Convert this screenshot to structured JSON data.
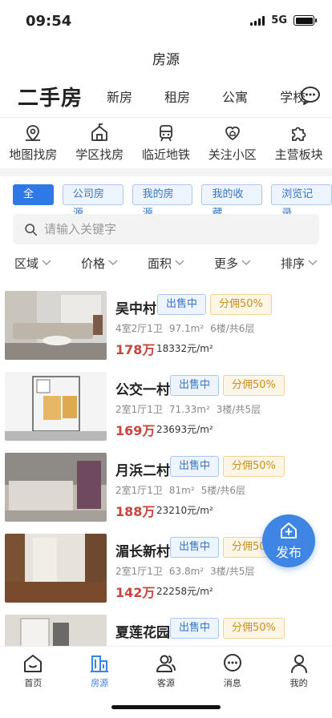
{
  "status": {
    "time": "09:54",
    "network": "5G"
  },
  "page_title": "房源",
  "tabs": {
    "main": "二手房",
    "others": [
      "新房",
      "租房",
      "公寓",
      "学校"
    ]
  },
  "quick_links": [
    {
      "label": "地图找房",
      "icon": "map-pin-icon"
    },
    {
      "label": "学区找房",
      "icon": "school-icon"
    },
    {
      "label": "临近地铁",
      "icon": "subway-icon"
    },
    {
      "label": "关注小区",
      "icon": "heart-home-icon"
    },
    {
      "label": "主营板块",
      "icon": "puzzle-icon"
    }
  ],
  "chips": [
    "全部",
    "公司房源",
    "我的房源",
    "我的收藏",
    "浏览记录"
  ],
  "search": {
    "placeholder": "请输入关键字"
  },
  "sorts": [
    "区域",
    "价格",
    "面积",
    "更多",
    "排序"
  ],
  "listings": [
    {
      "name": "吴中村",
      "status": "出售中",
      "commission": "分佣50%",
      "layout": "4室2厅1卫",
      "area": "97.1m²",
      "floor": "6楼/共6层",
      "price": "178万",
      "unit_price": "18332元/m²"
    },
    {
      "name": "公交一村",
      "status": "出售中",
      "commission": "分佣50%",
      "layout": "2室1厅1卫",
      "area": "71.33m²",
      "floor": "3楼/共5层",
      "price": "169万",
      "unit_price": "23693元/m²"
    },
    {
      "name": "月浜二村",
      "status": "出售中",
      "commission": "分佣50%",
      "layout": "2室1厅1卫",
      "area": "81m²",
      "floor": "5楼/共6层",
      "price": "188万",
      "unit_price": "23210元/m²"
    },
    {
      "name": "湄长新村",
      "status": "出售中",
      "commission": "分佣50%",
      "layout": "2室1厅1卫",
      "area": "63.8m²",
      "floor": "3楼/共5层",
      "price": "142万",
      "unit_price": "22258元/m²"
    },
    {
      "name": "夏莲花园",
      "status": "出售中",
      "commission": "分佣50%",
      "layout": "",
      "area": "",
      "floor": "",
      "price": "",
      "unit_price": ""
    }
  ],
  "fab": {
    "label": "发布"
  },
  "bottom_nav": [
    {
      "label": "首页",
      "icon": "home-icon"
    },
    {
      "label": "房源",
      "icon": "building-icon",
      "active": true
    },
    {
      "label": "客源",
      "icon": "customers-icon"
    },
    {
      "label": "消息",
      "icon": "message-icon"
    },
    {
      "label": "我的",
      "icon": "profile-icon"
    }
  ],
  "colors": {
    "accent": "#2f79e6",
    "price": "#c9443c",
    "commission": "#c88f1f"
  }
}
